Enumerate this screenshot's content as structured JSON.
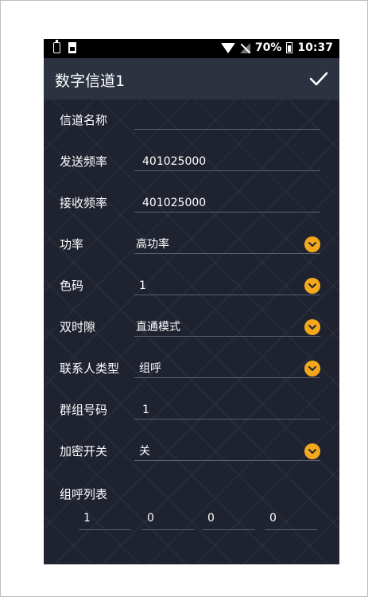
{
  "status_bar": {
    "battery_percent": "70%",
    "time": "10:37"
  },
  "app_bar": {
    "title": "数字信道1",
    "confirm_icon": "check-icon"
  },
  "form": {
    "channel_name": {
      "label": "信道名称",
      "value": ""
    },
    "tx_freq": {
      "label": "发送频率",
      "value": "401025000"
    },
    "rx_freq": {
      "label": "接收频率",
      "value": "401025000"
    },
    "power": {
      "label": "功率",
      "value": "高功率"
    },
    "color_code": {
      "label": "色码",
      "value": "1"
    },
    "dual_slot": {
      "label": "双时隙",
      "value": "直通模式"
    },
    "contact_type": {
      "label": "联系人类型",
      "value": "组呼"
    },
    "group_number": {
      "label": "群组号码",
      "value": "1"
    },
    "encryption": {
      "label": "加密开关",
      "value": "关"
    },
    "group_list": {
      "label": "组呼列表",
      "values": [
        "1",
        "0",
        "0",
        "0"
      ]
    }
  },
  "colors": {
    "accent": "#f3a81c",
    "appbar": "#2c3240",
    "background": "#1f2330"
  }
}
